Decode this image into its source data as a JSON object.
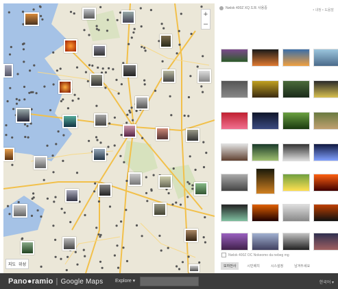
{
  "map": {
    "zoom_in": "+",
    "zoom_out": "–",
    "maptype": {
      "map": "지도",
      "satellite": "위성"
    }
  },
  "header": {
    "user_text": "Nwlok 400Z XQ 드트 사용중",
    "menu_text": "• 내정 • 도움말"
  },
  "sidebar_note": "Nwlok 400Z OC Nokeomo da nebeg mg",
  "sidebar_tabs": [
    "모자전사",
    "시민배치",
    "시스설정",
    "남겨두세요"
  ],
  "bottom": {
    "logo_left": "Pano",
    "logo_right": "ramio",
    "separator": "|",
    "google_maps": "Google Maps",
    "explore": "Explore ▾",
    "language": "한국어 ▾"
  },
  "colors": {
    "water": "#a5c2e6",
    "land": "#ebe7d8",
    "road": "#f2c04a",
    "bar": "#3b3b3b"
  }
}
